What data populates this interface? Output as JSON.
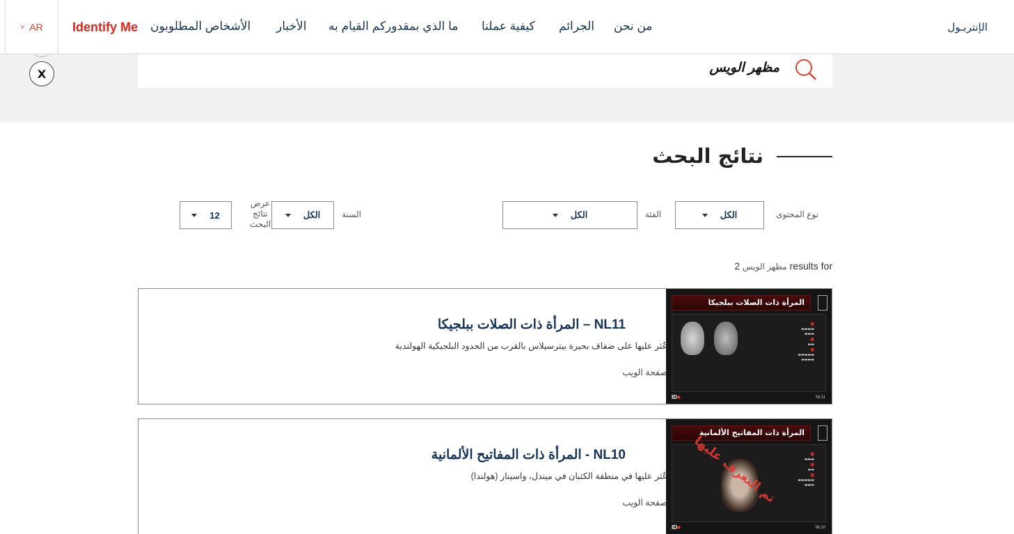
{
  "nav": {
    "brand": "الإنتربـول",
    "language": "AR",
    "identify": "Identify Me",
    "items": [
      "من نحن",
      "الجرائم",
      "كيفية عملنا",
      "ما الذي بمقدوركم القيام به",
      "الأخبار",
      "الأشخاص المطلوبون"
    ]
  },
  "search": {
    "query": "مظهر الويس"
  },
  "social": {
    "x_label": "X"
  },
  "results": {
    "heading": "نتائج البحث",
    "summary": "2 results for",
    "summary_query": "مظهر الويس"
  },
  "filters": {
    "content_type": {
      "label": "نوع المحتوى",
      "value": "الكل"
    },
    "category": {
      "label": "الفئة",
      "value": "الكل"
    },
    "year": {
      "label": "السنة",
      "value": "الكل"
    },
    "per_page": {
      "label": "عرض نتائج البحث",
      "value": "12"
    }
  },
  "cards": [
    {
      "title": "NL11 – المرأة ذات الصلات ببلجيكا",
      "description": "عُثر عليها على ضفاف بحيرة بيترسيلاس بالقرب من الحدود البلجيكية الهولندية",
      "type": "صفحة الويب",
      "thumb_title": "المرأة ذات الصلات ببلجيكا",
      "thumb_code": "NL11"
    },
    {
      "title": "NL10 - المرأة ذات المفاتيح الألمانية",
      "description": "عُثر عليها في منطقة الكثبان في ميندل، واسينار (هولندا)",
      "type": "صفحة الويب",
      "thumb_title": "المرأة ذات المفاتيح الألمانية",
      "thumb_code": "NL10",
      "stamp": "تم التعرف عليها"
    }
  ],
  "colors": {
    "accent": "#e1251b",
    "navy": "#13325a",
    "band": "#f1f1f1"
  }
}
